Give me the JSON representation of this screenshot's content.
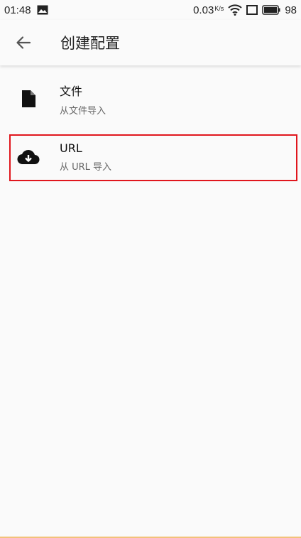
{
  "status_bar": {
    "time": "01:48",
    "speed_value": "0.03",
    "speed_unit": "K/s",
    "battery_level": "98",
    "icons": [
      "image-icon",
      "wifi-icon",
      "sim-icon",
      "battery-icon"
    ]
  },
  "app_bar": {
    "title": "创建配置",
    "back_icon": "arrow-left-icon"
  },
  "options": [
    {
      "title": "文件",
      "subtitle": "从文件导入",
      "icon": "file-icon"
    },
    {
      "title": "URL",
      "subtitle": "从 URL 导入",
      "icon": "cloud-download-icon"
    }
  ],
  "colors": {
    "background": "#fafafa",
    "highlight": "#e0161d",
    "text_primary": "#111111",
    "text_secondary": "#666666"
  }
}
